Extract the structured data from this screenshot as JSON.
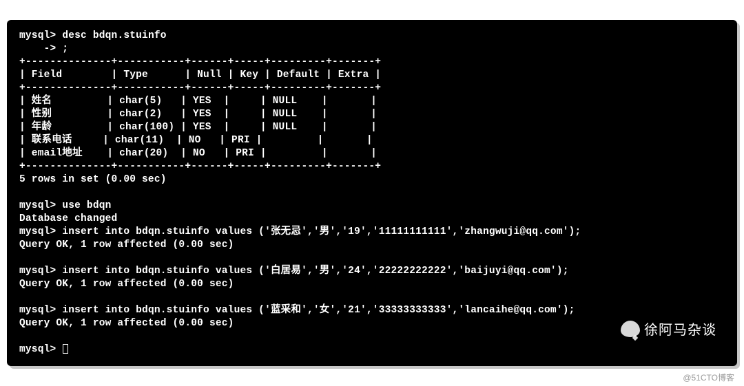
{
  "terminal": {
    "prompt": "mysql>",
    "cont_prompt": "    -> ",
    "cmd_desc": "desc bdqn.stuinfo",
    "cmd_cont": ";",
    "table": {
      "border_top": "+--------------+-----------+------+-----+---------+-------+",
      "header": "| Field        | Type      | Null | Key | Default | Extra |",
      "border_mid": "+--------------+-----------+------+-----+---------+-------+",
      "rows": [
        "| 姓名         | char(5)   | YES  |     | NULL    |       |",
        "| 性别         | char(2)   | YES  |     | NULL    |       |",
        "| 年龄         | char(100) | YES  |     | NULL    |       |",
        "| 联系电话     | char(11)  | NO   | PRI |         |       |",
        "| email地址    | char(20)  | NO   | PRI |         |       |"
      ],
      "border_bot": "+--------------+-----------+------+-----+---------+-------+"
    },
    "rows_msg": "5 rows in set (0.00 sec)",
    "cmd_use": "use bdqn",
    "db_changed": "Database changed",
    "insert1_cmd": "insert into bdqn.stuinfo values ('张无忌','男','19','11111111111','zhangwuji@qq.com');",
    "insert1_res": "Query OK, 1 row affected (0.00 sec)",
    "insert2_cmd": "insert into bdqn.stuinfo values ('白居易','男','24','22222222222','baijuyi@qq.com');",
    "insert2_res": "Query OK, 1 row affected (0.00 sec)",
    "insert3_cmd": "insert into bdqn.stuinfo values ('蓝采和','女','21','33333333333','lancaihe@qq.com');",
    "insert3_res": "Query OK, 1 row affected (0.00 sec)"
  },
  "watermark": {
    "name": "徐阿马杂谈",
    "footer": "@51CTO博客"
  }
}
